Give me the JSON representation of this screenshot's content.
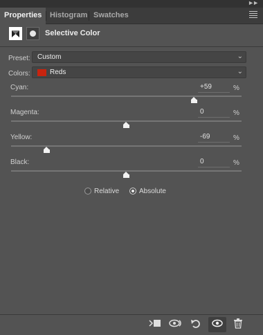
{
  "tabs": [
    {
      "label": "Properties",
      "active": true
    },
    {
      "label": "Histogram",
      "active": false
    },
    {
      "label": "Swatches",
      "active": false
    }
  ],
  "header": {
    "title": "Selective Color"
  },
  "preset": {
    "label": "Preset:",
    "value": "Custom"
  },
  "colors": {
    "label": "Colors:",
    "value": "Reds",
    "swatch": "#c8240f"
  },
  "sliders": [
    {
      "label": "Cyan:",
      "value": "+59",
      "unit": "%",
      "level": 59
    },
    {
      "label": "Magenta:",
      "value": "0",
      "unit": "%",
      "level": 0
    },
    {
      "label": "Yellow:",
      "value": "-69",
      "unit": "%",
      "level": -69
    },
    {
      "label": "Black:",
      "value": "0",
      "unit": "%",
      "level": 0
    }
  ],
  "method": {
    "relative": {
      "label": "Relative",
      "selected": false
    },
    "absolute": {
      "label": "Absolute",
      "selected": true
    }
  },
  "footer_icons": [
    "clip-to-layer-icon",
    "view-previous-state-icon",
    "reset-icon",
    "visibility-eye-icon",
    "delete-trash-icon"
  ]
}
